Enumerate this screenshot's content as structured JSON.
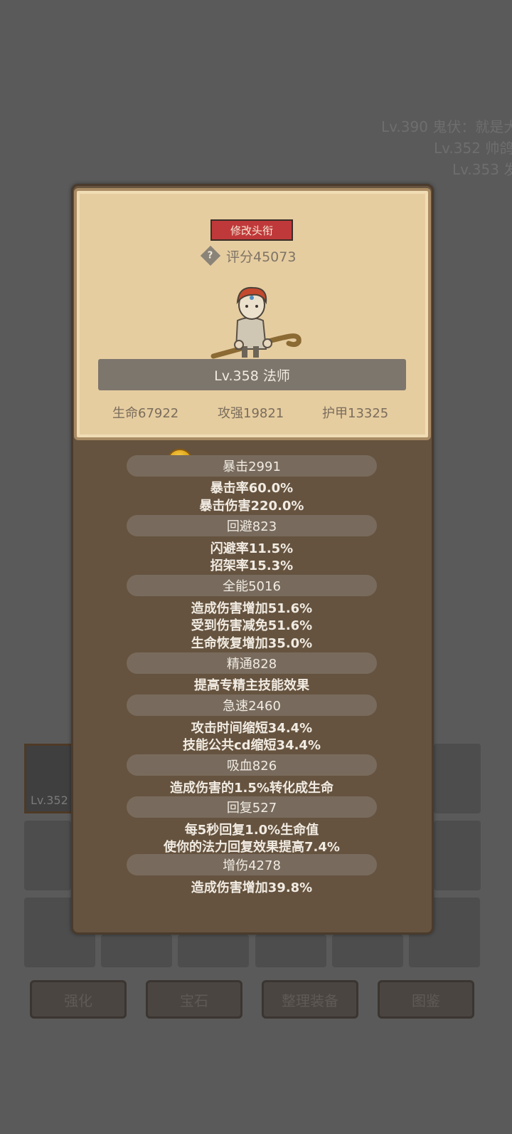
{
  "background": {
    "log_lines": [
      "Lv.390 鬼伏：就是大",
      "Lv.352 帅鸽",
      "Lv.353 发"
    ],
    "slot_item_level": "Lv.352",
    "bottom_buttons": [
      "强化",
      "宝石",
      "整理装备",
      "图鉴"
    ]
  },
  "profile": {
    "edit_title_label": "修改头衔",
    "help_glyph": "?",
    "score": "评分45073",
    "class_label": "Lv.358 法师",
    "main_stats": [
      "生命67922",
      "攻强19821",
      "护甲13325"
    ]
  },
  "stats": {
    "crit_head": "暴击2991",
    "crit_lines": [
      "暴击率60.0%",
      "暴击伤害220.0%"
    ],
    "dodge_head": "回避823",
    "dodge_lines": [
      "闪避率11.5%",
      "招架率15.3%"
    ],
    "versatility_head": "全能5016",
    "versatility_lines": [
      "造成伤害增加51.6%",
      "受到伤害减免51.6%",
      "生命恢复增加35.0%"
    ],
    "mastery_head": "精通828",
    "mastery_lines": [
      "提高专精主技能效果"
    ],
    "haste_head": "急速2460",
    "haste_lines": [
      "攻击时间缩短34.4%",
      "技能公共cd缩短34.4%"
    ],
    "leech_head": "吸血826",
    "leech_lines": [
      "造成伤害的1.5%转化成生命"
    ],
    "regen_head": "回复527",
    "regen_lines": [
      "每5秒回复1.0%生命值",
      "使你的法力回复效果提高7.4%"
    ],
    "damage_head": "增伤4278",
    "damage_lines": [
      "造成伤害增加39.8%"
    ]
  },
  "colors": {
    "overlay": "#5a5a5a",
    "panel": "#65533f",
    "card": "#e6cda0",
    "accent_red": "#c0393a",
    "text_light": "#f1ebe2"
  }
}
